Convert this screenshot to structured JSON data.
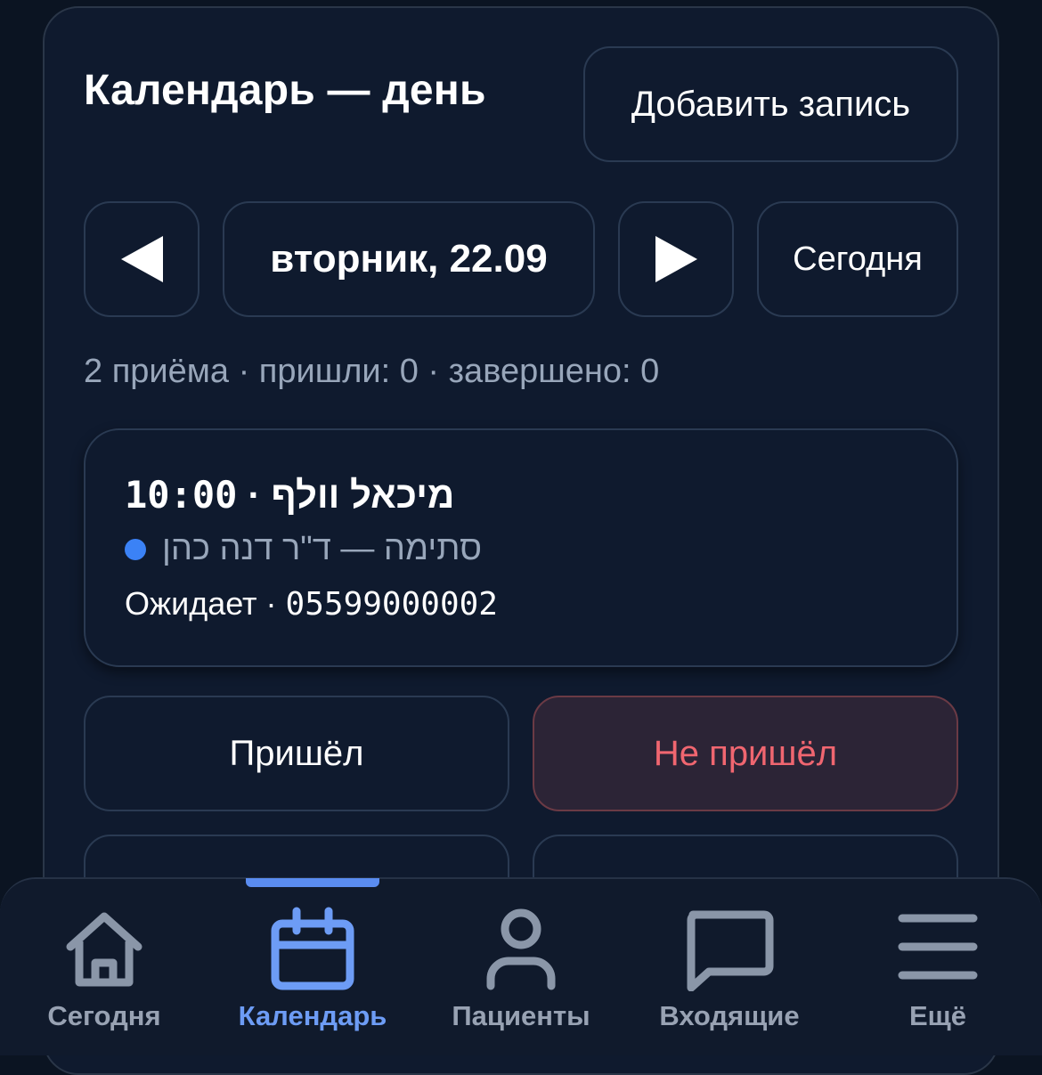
{
  "header": {
    "title": "Календарь — день",
    "add_label": "Добавить запись"
  },
  "date_nav": {
    "prev_icon": "triangle-left-icon",
    "date_label": "вторник, 22.09",
    "next_icon": "triangle-right-icon",
    "today_label": "Сегодня"
  },
  "summary": "2 приёма · пришли: 0 · завершено: 0",
  "appointment": {
    "time": "10:00",
    "separator": "·",
    "patient": "מיכאל וולף",
    "service_doctor": "סתימה — ד\"ר דנה כהן",
    "status": "Ожидает",
    "phone": "05599000002",
    "dot_color": "#3b82f6"
  },
  "actions": {
    "came_label": "Пришёл",
    "noshow_label": "Не пришёл"
  },
  "bottom_nav": {
    "active": "calendar",
    "accent_color": "#6d9cf5",
    "items": [
      {
        "label": "Сегодня",
        "icon": "home-icon"
      },
      {
        "label": "Календарь",
        "icon": "calendar-icon"
      },
      {
        "label": "Пациенты",
        "icon": "user-icon"
      },
      {
        "label": "Входящие",
        "icon": "chat-icon"
      },
      {
        "label": "Ещё",
        "icon": "menu-icon"
      }
    ]
  }
}
